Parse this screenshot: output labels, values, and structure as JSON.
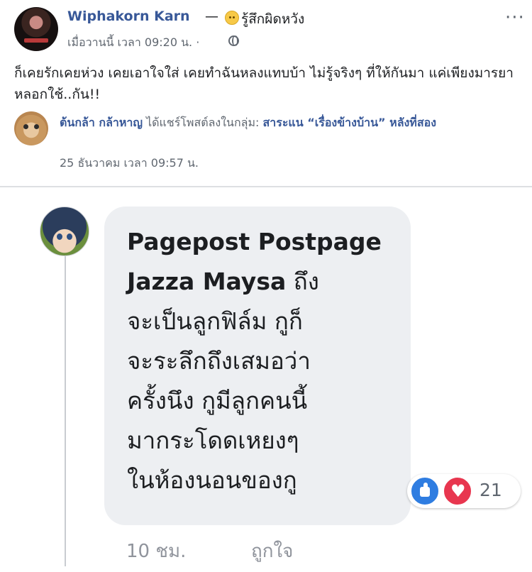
{
  "post": {
    "author": "Wiphakorn Karn",
    "feeling_separator": "—",
    "feeling_icon": "sad-face-emoji",
    "feeling": "รู้สึกผิดหวัง",
    "timestamp": "เมื่อวานนี้ เวลา 09:20 น. ·",
    "privacy_icon": "globe-icon",
    "more_icon": "···",
    "text": "ก็เคยรักเคยห่วง เคยเอาใจใส่ เคยทำฉันหลงแทบบ้า ไม่รู้จริงๆ ที่ให้กันมา แค่เพียงมารยาหลอกใช้..กัน!!"
  },
  "share": {
    "sharer": "ต้นกล้า กล้าหาญ",
    "action": " ได้แชร์โพสต์ลงในกลุ่ม: ",
    "group": "สาระแน “เรื่องข้างบ้าน” หลังที่สอง",
    "timestamp": "25 ธันวาคม เวลา 09:57 น."
  },
  "comment": {
    "commenter": "Pagepost Postpage",
    "tagged": "Jazza Maysa",
    "text_inline": " ถึง",
    "text_lines": [
      "จะเป็นลูกฟิล์ม กูก็",
      "จะระลึกถึงเสมอว่า",
      "ครั้งนึง กูมีลูกคนนี้",
      "มากระโดดเหยงๆ",
      "ในห้องนอนของกู"
    ],
    "reactions": {
      "like_icon": "like-icon",
      "love_icon": "love-icon",
      "count": "21"
    },
    "time": "10 ชม.",
    "like_label": "ถูกใจ"
  },
  "colors": {
    "link": "#385898",
    "secondary_text": "#606770",
    "bubble": "#edeff2",
    "like_blue": "#2f7de1",
    "love_red": "#e8364f"
  }
}
